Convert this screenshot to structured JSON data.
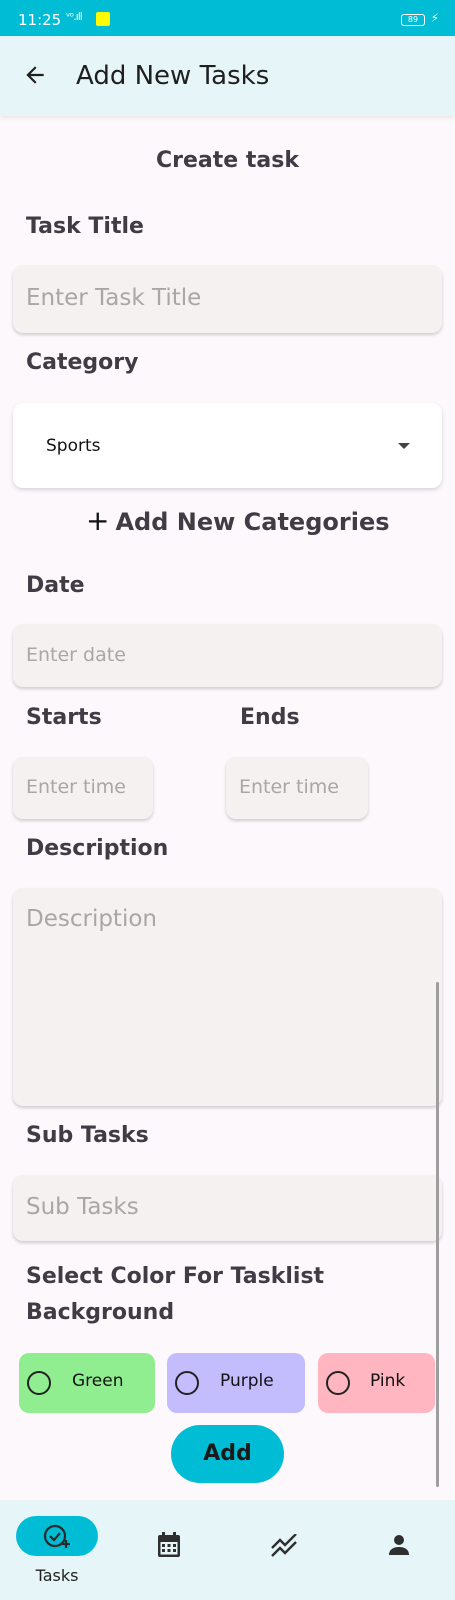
{
  "status_bar": {
    "time": "11:25",
    "battery": "89"
  },
  "app_bar": {
    "title": "Add New Tasks",
    "back_icon": "arrow-left-icon"
  },
  "form": {
    "heading": "Create task",
    "task_title": {
      "label": "Task Title",
      "placeholder": "Enter Task Title"
    },
    "category": {
      "label": "Category",
      "selected": "Sports",
      "add_label": "Add New Categories"
    },
    "date": {
      "label": "Date",
      "placeholder": "Enter date"
    },
    "starts": {
      "label": "Starts",
      "placeholder": "Enter time"
    },
    "ends": {
      "label": "Ends",
      "placeholder": "Enter time"
    },
    "description": {
      "label": "Description",
      "placeholder": "Description"
    },
    "sub_tasks": {
      "label": "Sub Tasks",
      "placeholder": "Sub Tasks"
    },
    "color_select": {
      "label_line1": "Select Color For Tasklist",
      "label_line2": "Background",
      "options": [
        {
          "label": "Green",
          "color": "#90ee90"
        },
        {
          "label": "Purple",
          "color": "#c3bcfd"
        },
        {
          "label": "Pink",
          "color": "#ffb6c1"
        }
      ]
    },
    "add_button": "Add"
  },
  "bottom_nav": {
    "items": [
      {
        "label": "Tasks",
        "icon": "task-add-icon",
        "active": true
      },
      {
        "label": "",
        "icon": "calendar-icon"
      },
      {
        "label": "",
        "icon": "analytics-icon"
      },
      {
        "label": "",
        "icon": "person-icon"
      }
    ]
  },
  "colors": {
    "accent": "#00bcd4",
    "field_bg": "#f4f1f0",
    "page_bg": "#fdf8fc",
    "app_bar_bg": "#e6f5f8"
  }
}
